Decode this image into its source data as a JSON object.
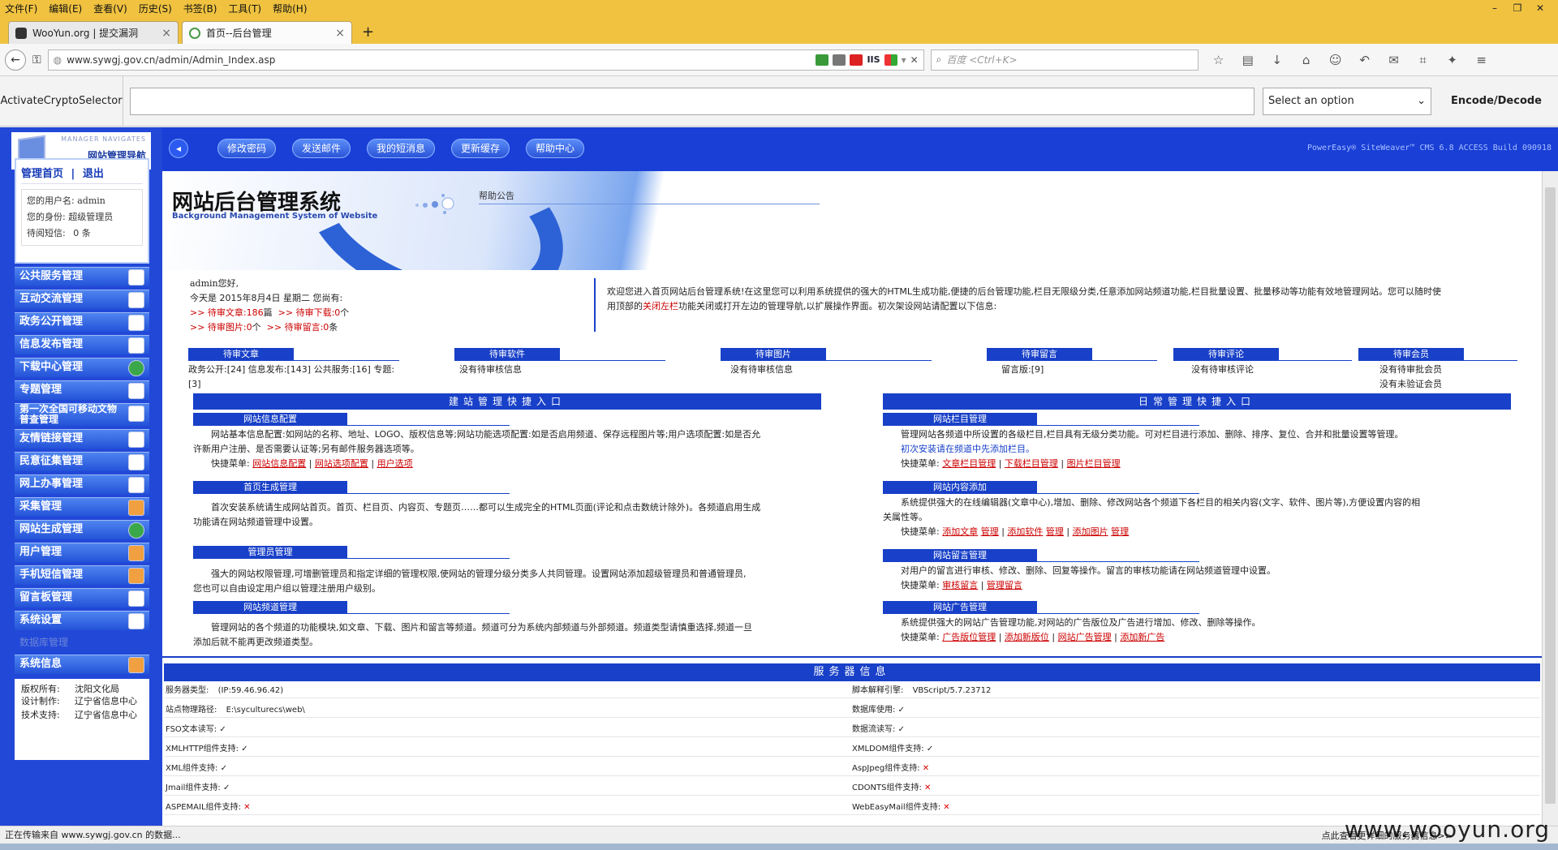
{
  "browser": {
    "menu": [
      "文件(F)",
      "编辑(E)",
      "查看(V)",
      "历史(S)",
      "书签(B)",
      "工具(T)",
      "帮助(H)"
    ],
    "tabs": [
      {
        "label": "WooYun.org | 提交漏洞"
      },
      {
        "label": "首页--后台管理"
      }
    ],
    "url": "www.sywgj.gov.cn/admin/Admin_Index.asp",
    "search_placeholder": "百度 <Ctrl+K>",
    "hackbar": {
      "label": "ActivateCryptoSelector",
      "select_value": "Select an option",
      "button": "Encode/Decode"
    },
    "status": "正在传输来自 www.sywgj.gov.cn 的数据..."
  },
  "sidebar": {
    "logo_small": "MANAGER NAVIGATES",
    "logo_title": "网站管理导航",
    "links": {
      "home": "管理首页",
      "sep": "|",
      "logout": "退出"
    },
    "user": {
      "username_label": "您的用户名:",
      "username": "admin",
      "role_label": "您的身份:",
      "role": "超级管理员",
      "msg_label": "待阅短信:",
      "msg_count": "0",
      "msg_unit": "条"
    },
    "items": [
      {
        "label": "公共服务管理"
      },
      {
        "label": "互动交流管理"
      },
      {
        "label": "政务公开管理"
      },
      {
        "label": "信息发布管理"
      },
      {
        "label": "下载中心管理"
      },
      {
        "label": "专题管理"
      },
      {
        "label": "第一次全国可移动文物普查管理"
      },
      {
        "label": "友情链接管理"
      },
      {
        "label": "民意征集管理"
      },
      {
        "label": "网上办事管理"
      },
      {
        "label": "采集管理"
      },
      {
        "label": "网站生成管理"
      },
      {
        "label": "用户管理"
      },
      {
        "label": "手机短信管理"
      },
      {
        "label": "留言板管理"
      },
      {
        "label": "系统设置"
      }
    ],
    "faded_item": "数据库管理",
    "info_title": "系统信息",
    "info": [
      {
        "k": "版权所有:",
        "v": "沈阳文化局"
      },
      {
        "k": "设计制作:",
        "v": "辽宁省信息中心"
      },
      {
        "k": "技术支持:",
        "v": "辽宁省信息中心"
      }
    ]
  },
  "topbar": {
    "buttons": [
      "修改密码",
      "发送邮件",
      "我的短消息",
      "更新缓存",
      "帮助中心"
    ],
    "version": "PowerEasy® SiteWeaver™ CMS 6.8 ACCESS Build 090918"
  },
  "banner": {
    "title": "网站后台管理系统",
    "subtitle": "Background Management System of Website",
    "label": "帮助公告"
  },
  "greeting": {
    "hello": "admin您好,",
    "today": "今天是 2015年8月4日 星期二 您尚有:",
    "line1a": ">> 待审文章:",
    "line1a_val": "186",
    "line1a_unit": "篇",
    "line1b": ">> 待审下载:",
    "line1b_val": "0",
    "line1b_unit": "个",
    "line2a": ">> 待审图片:",
    "line2a_val": "0",
    "line2a_unit": "个",
    "line2b": ">> 待审留言:",
    "line2b_val": "0",
    "line2b_unit": "条"
  },
  "welcome": {
    "line1": "欢迎您进入首页网站后台管理系统!在这里您可以利用系统提供的强大的HTML生成功能,便捷的后台管理功能,栏目无限级分类,任意添加网站频道功能,栏目批量设置、批量移动等功能有效地管理网站。您可以随时使",
    "line2a": "用顶部的",
    "line2_link": "关闭左栏",
    "line2b": "功能关闭或打开左边的管理导航,以扩展操作界面。初次架设网站请配置以下信息:"
  },
  "pending": [
    {
      "title": "待审文章",
      "lines": [
        "政务公开:[24] 信息发布:[143] 公共服务:[16] 专题:",
        "[3]"
      ]
    },
    {
      "title": "待审软件",
      "lines": [
        "没有待审核信息"
      ]
    },
    {
      "title": "待审图片",
      "lines": [
        "没有待审核信息"
      ]
    },
    {
      "title": "待审留言",
      "lines": [
        "留言版:[9]"
      ]
    },
    {
      "title": "待审评论",
      "lines": [
        "没有待审核评论"
      ]
    },
    {
      "title": "待审会员",
      "lines": [
        "没有待审批会员",
        "没有未验证会员"
      ]
    }
  ],
  "quick_build": {
    "title": "建站管理快捷入口",
    "sections": [
      {
        "title": "网站信息配置",
        "lines": [
          "网站基本信息配置:如网站的名称、地址、LOGO、版权信息等;网站功能选项配置:如是否启用频道、保存远程图片等;用户选项配置:如是否允",
          "许新用户注册、是否需要认证等;另有邮件服务器选项等。"
        ],
        "menu_label": "快捷菜单:",
        "links": [
          "网站信息配置",
          "网站选项配置",
          "用户选项"
        ]
      },
      {
        "title": "首页生成管理",
        "lines": [
          "首次安装系统请生成网站首页。首页、栏目页、内容页、专题页……都可以生成完全的HTML页面(评论和点击数统计除外)。各频道启用生成",
          "功能请在网站频道管理中设置。"
        ]
      },
      {
        "title": "管理员管理",
        "lines": [
          "强大的网站权限管理,可增删管理员和指定详细的管理权限,使网站的管理分级分类多人共同管理。设置网站添加超级管理员和普通管理员,",
          "您也可以自由设定用户组以管理注册用户级别。"
        ]
      },
      {
        "title": "网站频道管理",
        "lines": [
          "管理网站的各个频道的功能模块,如文章、下载、图片和留言等频道。频道可分为系统内部频道与外部频道。频道类型请慎重选择,频道一旦",
          "添加后就不能再更改频道类型。"
        ]
      }
    ]
  },
  "quick_daily": {
    "title": "日常管理快捷入口",
    "sections": [
      {
        "title": "网站栏目管理",
        "lines": [
          "管理网站各频道中所设置的各级栏目,栏目具有无级分类功能。可对栏目进行添加、删除、排序、复位、合并和批量设置等管理。",
          "初次安装请在频道中先添加栏目。"
        ],
        "menu_label": "快捷菜单:",
        "links": [
          "文章栏目管理",
          "下载栏目管理",
          "图片栏目管理"
        ]
      },
      {
        "title": "网站内容添加",
        "lines": [
          "系统提供强大的在线编辑器(文章中心),增加、删除、修改网站各个频道下各栏目的相关内容(文字、软件、图片等),方便设置内容的相",
          "关属性等。"
        ],
        "menu_label": "快捷菜单:",
        "links": [
          "添加文章",
          "管理",
          "添加软件",
          "管理",
          "添加图片",
          "管理"
        ]
      },
      {
        "title": "网站留言管理",
        "lines": [
          "对用户的留言进行审核、修改、删除、回复等操作。留言的审核功能请在网站频道管理中设置。"
        ],
        "menu_label": "快捷菜单:",
        "links": [
          "审核留言",
          "管理留言"
        ]
      },
      {
        "title": "网站广告管理",
        "lines": [
          "系统提供强大的网站广告管理功能,对网站的广告版位及广告进行增加、修改、删除等操作。"
        ],
        "menu_label": "快捷菜单:",
        "links": [
          "广告版位管理",
          "添加新版位",
          "网站广告管理",
          "添加新广告"
        ]
      }
    ]
  },
  "server": {
    "title": "服务器信息",
    "rows": [
      {
        "l": "服务器类型:",
        "lv": "(IP:59.46.96.42)",
        "r": "脚本解释引擎:",
        "rv": "VBScript/5.7.23712"
      },
      {
        "l": "站点物理路径:",
        "lv": "E:\\syculturecs\\web\\",
        "r": "数据库使用:",
        "rv": "✓"
      },
      {
        "l": "FSO文本读写:",
        "lv": "✓",
        "r": "数据流读写:",
        "rv": "✓"
      },
      {
        "l": "XMLHTTP组件支持:",
        "lv": "✓",
        "r": "XMLDOM组件支持:",
        "rv": "✓"
      },
      {
        "l": "XML组件支持:",
        "lv": "✓",
        "r": "AspJpeg组件支持:",
        "rv": "✕"
      },
      {
        "l": "Jmail组件支持:",
        "lv": "✓",
        "r": "CDONTS组件支持:",
        "rv": "✕"
      },
      {
        "l": "ASPEMAIL组件支持:",
        "lv": "✕",
        "r": "WebEasyMail组件支持:",
        "rv": "✕"
      }
    ]
  },
  "watermark": "www.wooyun.org",
  "watermark_sub": "点此查看更详细的服务器信息>>",
  "colors": {
    "brand_blue": "#1840c8",
    "link_red": "#c00000"
  }
}
